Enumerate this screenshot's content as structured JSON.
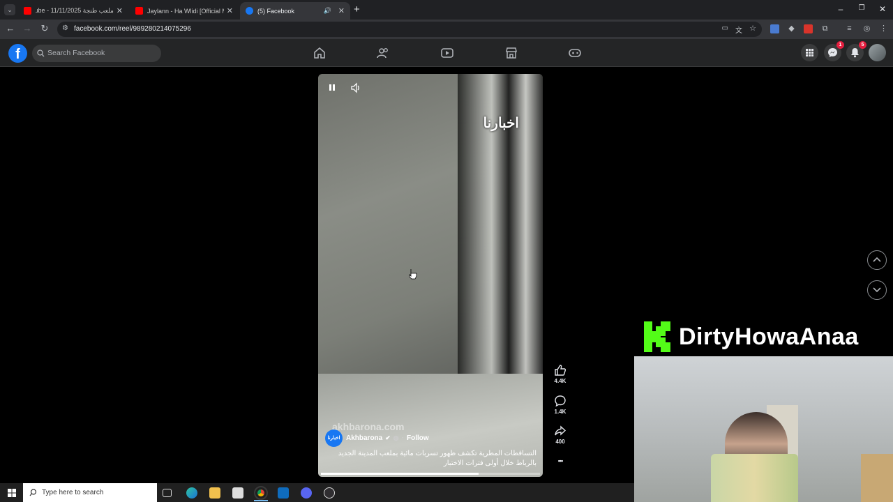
{
  "browser": {
    "tabs": [
      {
        "title": "ملعب طنجة 11/11/2025 - YouTube",
        "close": "✕",
        "favicon_color": "#ff0000"
      },
      {
        "title": "Jaylann - Ha Wlidi [Official Music Video]",
        "close": "✕",
        "favicon_color": "#ff0000"
      },
      {
        "title": "(5) Facebook",
        "close": "✕",
        "favicon_color": "#1877f2"
      }
    ],
    "new_tab": "+",
    "url": "facebook.com/reel/989280214075296"
  },
  "facebook": {
    "logo": "f",
    "search_placeholder": "Search Facebook",
    "messenger_badge": "1",
    "notifications_badge": "5"
  },
  "reel": {
    "watermark": "اخبارنا",
    "site_watermark": "akhbarona.com",
    "author": "Akhbarona",
    "avatar_text": "اخبارنا",
    "follow_label": "Follow",
    "caption": "التساقطات المطرية تكشف ظهور تسربات مائية بملعب المدينة الجديد بالرباط خلال أولى فترات الاختبار",
    "progress": 0.72,
    "likes": "4.4K",
    "comments": "1.4K",
    "shares": "400",
    "more": "•••"
  },
  "overlay": {
    "streamer_name": "DirtyHowaAnaa",
    "brand_color": "#53fc18"
  },
  "taskbar": {
    "search_placeholder": "Type here to search"
  }
}
